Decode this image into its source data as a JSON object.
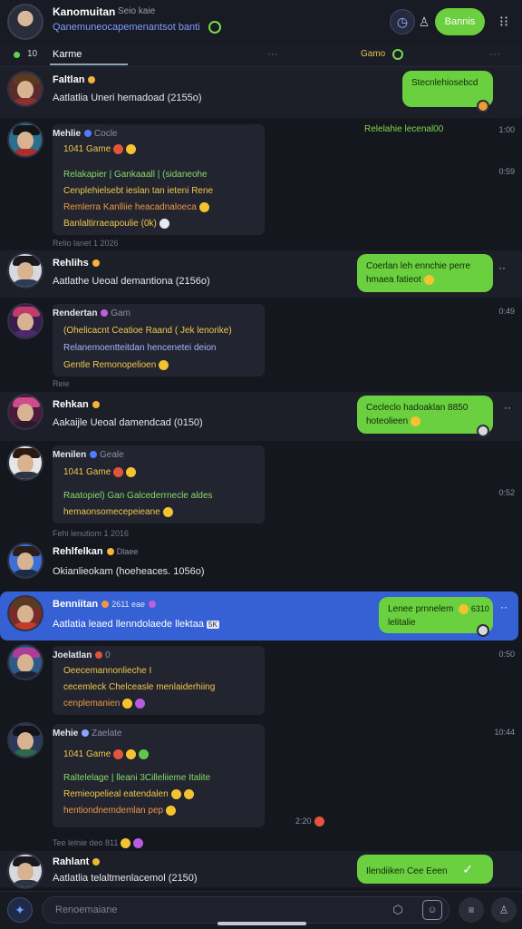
{
  "colors": {
    "accent_green": "#6bd03f",
    "highlight_blue": "#3561d4",
    "background": "#15171f"
  },
  "header": {
    "name": "Kanomuitan",
    "meta": "Seio kaie",
    "subtitle": "Qanemuneocapemenantsot banti",
    "join_label": "Bannis",
    "icons": [
      "clock-icon",
      "person-icon",
      "more-icon"
    ]
  },
  "tabs": {
    "count": "10",
    "active": "Karme",
    "game_label": "Gamo"
  },
  "rows": [
    {
      "name": "Faltlan",
      "text": "Aatlatlia Uneri hemadoad (2155o)",
      "bubble": "Stecnlehiosebcd"
    },
    {
      "name": "Mehlie",
      "meta": "Cocle",
      "green_label": "Relelahie lecenal00",
      "time": "1:00",
      "time2": "0:59",
      "card": [
        "1041 Game",
        "Relakapier | Gankaaall | (sidaneohe",
        "Cenplehielsebt ieslan tan ieteni Rene",
        "Remlerra Kanlliie heacadnaloeca",
        "Banlaltirraeapoulie (0k)"
      ]
    },
    {
      "label": "Relio lanet 1 2026"
    },
    {
      "name": "Rehlihs",
      "text": "Aatlathe Ueoal demantiona (2156o)",
      "bubble1": "Coerlan leh ennchie perre",
      "bubble2": "hmaea fatieot"
    },
    {
      "name": "Rendertan",
      "meta": "Gam",
      "time": "0:49",
      "card": [
        "(Ohelicacnt Ceatioe Raand ( Jek lenorike)",
        "Relanemoentteitdan hencenetei deion",
        "Gentle Remonopelioen"
      ]
    },
    {
      "label": "Reie"
    },
    {
      "name": "Rehkan",
      "text": "Aakaijle Ueoal damendcad (0150)",
      "bubble1": "Cecleclo hadoaklan 8850",
      "bubble2": "hoteolieen"
    },
    {
      "name": "Menilen",
      "meta": "Geale",
      "time": "0:52",
      "card": [
        "1041 Game",
        "Raatopiel) Gan Galcederrnecle aldes",
        "hemaonsomecepeieane"
      ]
    },
    {
      "label": "Fehi lenutiom 1 2016"
    },
    {
      "name": "Rehlfelkan",
      "meta": "Dlaee",
      "text": "Okianlieokam (hoeheaces. 1056o)"
    },
    {
      "name": "Benniitan",
      "meta": "2611 eae",
      "text": "Aatlatia leaed llenndolaede llektaa",
      "badge": "5K",
      "bubble1": "Lenee prnnelem",
      "bubble2": "lelitalie",
      "bubble_meta": "6310"
    },
    {
      "name": "Joelatlan",
      "meta": "0",
      "time": "0:50",
      "card": [
        "Oeecemannonlieche I",
        "cecemleck Chelceasle menlaiderhiing",
        "cenplemanien"
      ]
    },
    {
      "name": "Mehie",
      "meta": "Zaelate",
      "time": "10:44",
      "time2": "2:20",
      "card": [
        "1041 Game",
        "Raltelelage | lleani 3Cilleliieme Italite",
        "Remieopelieal eatendalen",
        "hentiondnemdemlan pep"
      ]
    },
    {
      "label": "Tee lelnie deo 811"
    },
    {
      "name": "Rahlant",
      "text": "Aatlatlia telaltmenlacemol (2150)",
      "bubble": "Ilendiiken Cee Eeen"
    }
  ],
  "composer": {
    "placeholder": "Renoemaiane"
  }
}
